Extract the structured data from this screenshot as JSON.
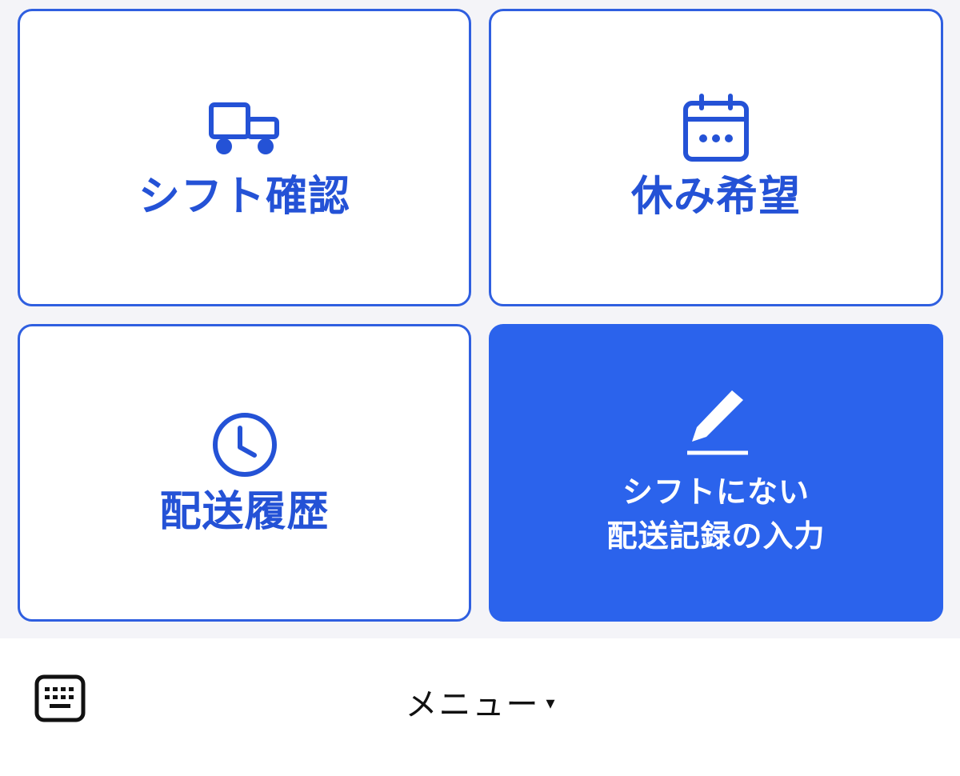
{
  "menu": {
    "tiles": [
      {
        "label": "シフト確認",
        "icon": "truck-icon"
      },
      {
        "label": "休み希望",
        "icon": "calendar-icon"
      },
      {
        "label": "配送履歴",
        "icon": "clock-icon"
      },
      {
        "label_lines": [
          "シフトにない",
          "配送記録の入力"
        ],
        "icon": "pencil-icon",
        "style": "primary"
      }
    ]
  },
  "bottom_bar": {
    "keyboard_icon": "keyboard-icon",
    "menu_label": "メニュー",
    "menu_caret": "▾"
  },
  "colors": {
    "accent": "#2b63ec",
    "accent_text": "#2452d6",
    "background": "#f4f4f8",
    "tile_bg": "#ffffff",
    "bottom_bar_bg": "#ffffff"
  }
}
